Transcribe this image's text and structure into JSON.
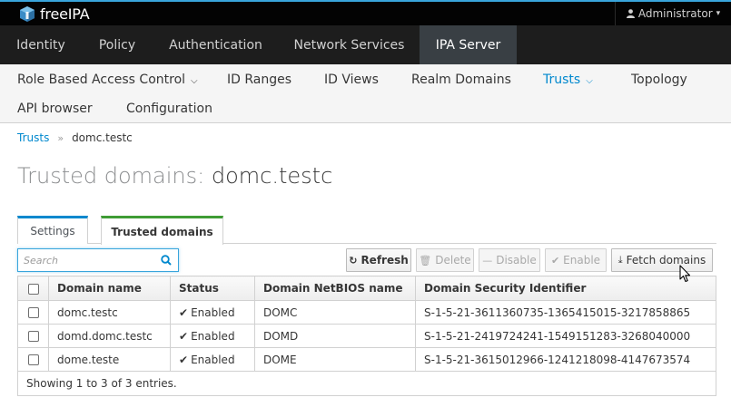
{
  "app": {
    "brand": "freeIPA"
  },
  "user_menu": {
    "label": "Administrator"
  },
  "primary_nav": [
    {
      "label": "Identity",
      "active": false
    },
    {
      "label": "Policy",
      "active": false
    },
    {
      "label": "Authentication",
      "active": false
    },
    {
      "label": "Network Services",
      "active": false
    },
    {
      "label": "IPA Server",
      "active": true
    }
  ],
  "secondary_nav": [
    {
      "label": "Role Based Access Control",
      "has_dropdown": true,
      "active": false
    },
    {
      "label": "ID Ranges",
      "has_dropdown": false,
      "active": false
    },
    {
      "label": "ID Views",
      "has_dropdown": false,
      "active": false
    },
    {
      "label": "Realm Domains",
      "has_dropdown": false,
      "active": false
    },
    {
      "label": "Trusts",
      "has_dropdown": true,
      "active": true
    },
    {
      "label": "Topology",
      "has_dropdown": false,
      "active": false
    },
    {
      "label": "API browser",
      "has_dropdown": false,
      "active": false
    },
    {
      "label": "Configuration",
      "has_dropdown": false,
      "active": false
    }
  ],
  "breadcrumb": {
    "parent": "Trusts",
    "separator": "»",
    "current": "domc.testc"
  },
  "page_title": {
    "prefix": "Trusted domains:",
    "name": "domc.testc"
  },
  "tabs": [
    {
      "label": "Settings",
      "active": false
    },
    {
      "label": "Trusted domains",
      "active": true
    }
  ],
  "search": {
    "placeholder": "Search",
    "value": ""
  },
  "actions": [
    {
      "label": "Refresh",
      "icon": "refresh-icon",
      "enabled": true
    },
    {
      "label": "Delete",
      "icon": "trash-icon",
      "enabled": false
    },
    {
      "label": "Disable",
      "icon": "minus-icon",
      "enabled": false
    },
    {
      "label": "Enable",
      "icon": "check-icon",
      "enabled": false
    },
    {
      "label": "Fetch domains",
      "icon": "download-icon",
      "enabled": true
    }
  ],
  "table": {
    "columns": [
      "Domain name",
      "Status",
      "Domain NetBIOS name",
      "Domain Security Identifier"
    ],
    "rows": [
      {
        "domain": "domc.testc",
        "status": "Enabled",
        "netbios": "DOMC",
        "sid": "S-1-5-21-3611360735-1365415015-3217858865"
      },
      {
        "domain": "domd.domc.testc",
        "status": "Enabled",
        "netbios": "DOMD",
        "sid": "S-1-5-21-2419724241-1549151283-3268040000"
      },
      {
        "domain": "dome.teste",
        "status": "Enabled",
        "netbios": "DOME",
        "sid": "S-1-5-21-3615012966-1241218098-4147673574"
      }
    ],
    "footer": "Showing 1 to 3 of 3 entries."
  },
  "colors": {
    "accent": "#0088ce",
    "top_accent": "#39a5dc",
    "active_tab_green": "#3f9c35",
    "nav_bg": "#1d1d1d",
    "nav_active_bg": "#393f44"
  }
}
